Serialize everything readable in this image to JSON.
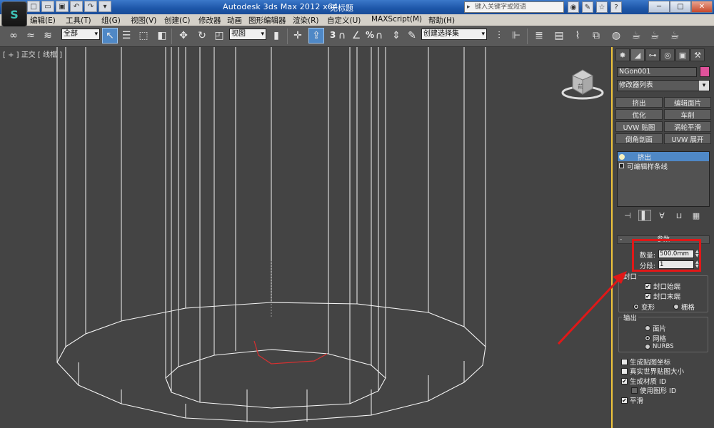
{
  "window": {
    "app_title": "Autodesk 3ds Max  2012 x64",
    "doc_title": "无标题",
    "search_placeholder": "键入关键字或短语",
    "logo_glyph": "S",
    "qa_icons": [
      "new-icon",
      "open-icon",
      "save-icon",
      "undo-icon",
      "redo-icon",
      "dropdown-icon"
    ],
    "controls": [
      "─",
      "□",
      "✕"
    ]
  },
  "menu": [
    "编辑(E)",
    "工具(T)",
    "组(G)",
    "视图(V)",
    "创建(C)",
    "修改器",
    "动画",
    "图形编辑器",
    "渲染(R)",
    "自定义(U)",
    "MAXScript(M)",
    "帮助(H)"
  ],
  "toolbar": {
    "selection_filter": "全部",
    "ref_coord": "视图",
    "snap_label": "3",
    "angle_snap_label": "%",
    "named_selection": "创建选择集"
  },
  "viewport": {
    "label": "[ + ] 正交 [ 线框 ]",
    "viewcube_face": "前"
  },
  "command_panel": {
    "object_name": "NGon001",
    "object_color": "#e0529b",
    "modifier_list": "修改器列表",
    "modifier_buttons": [
      "挤出",
      "编辑面片",
      "优化",
      "车削",
      "UVW 贴图",
      "涡轮平滑",
      "倒角剖面",
      "UVW 展开"
    ],
    "stack": [
      {
        "label": "挤出",
        "selected": true
      },
      {
        "label": "可编辑样条线",
        "selected": false
      }
    ],
    "rollout_title": "参数",
    "params": {
      "amount_label": "数量:",
      "amount_value": "500.0mm",
      "segments_label": "分段:",
      "segments_value": "1"
    },
    "capping": {
      "title": "封口",
      "cap_start": "封口始端",
      "cap_end": "封口末端",
      "morph": "变形",
      "grid": "栅格"
    },
    "output": {
      "title": "输出",
      "patch": "面片",
      "mesh": "网格",
      "nurbs": "NURBS"
    },
    "options": {
      "gen_map_coords": "生成贴图坐标",
      "real_world": "真实世界贴图大小",
      "gen_mat_ids": "生成材质 ID",
      "use_shape_ids": "使用图形 ID",
      "smooth": "平滑"
    }
  },
  "colors": {
    "highlight": "#e01818",
    "selection_blue": "#4f88c6",
    "viewport_border": "#f0c43b"
  }
}
